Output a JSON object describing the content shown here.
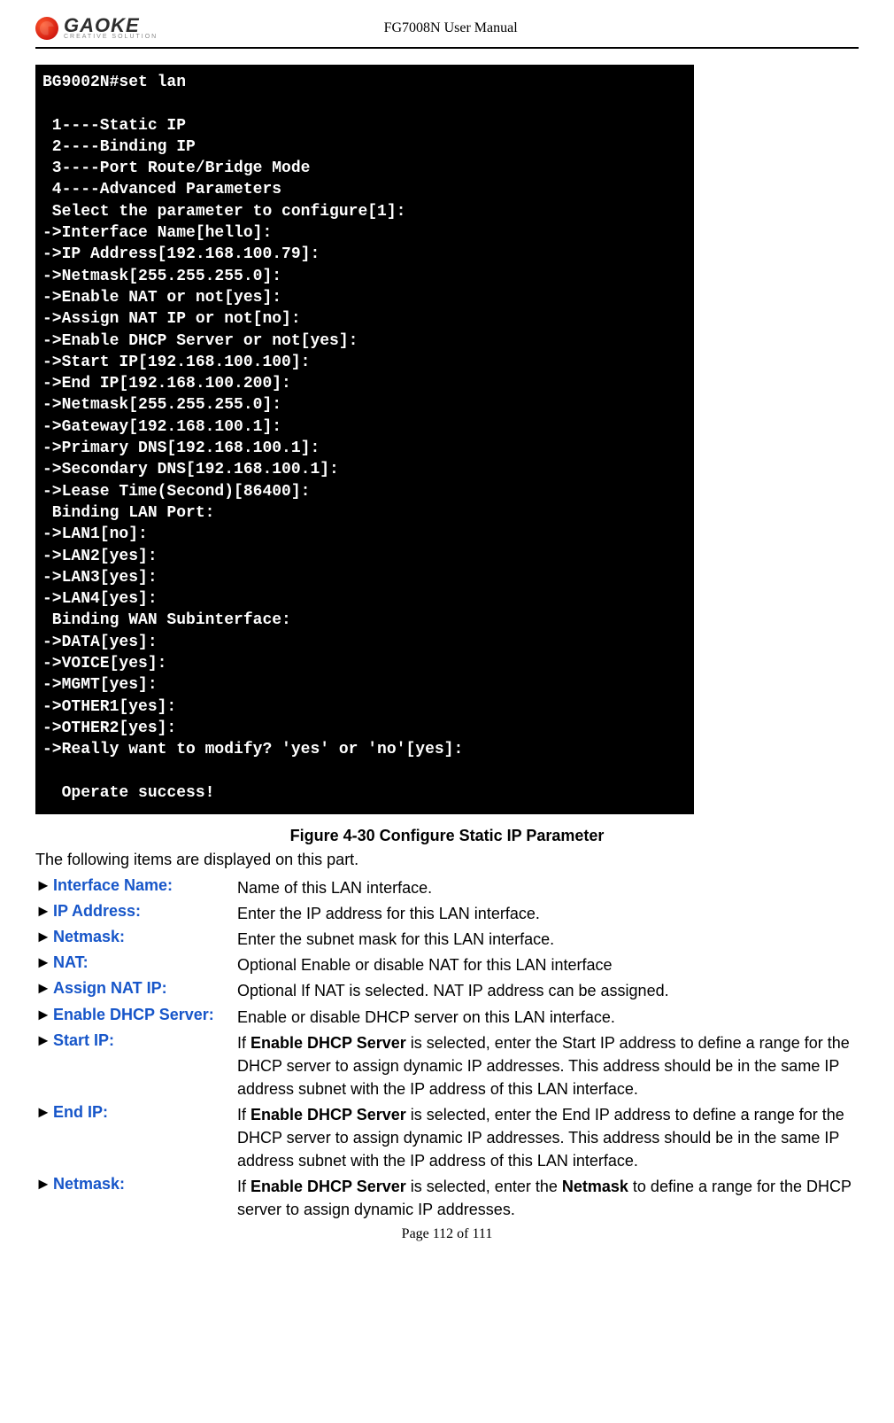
{
  "header": {
    "logo_text": "GAOKE",
    "logo_sub": "CREATIVE SOLUTION",
    "doc_title": "FG7008N User Manual"
  },
  "terminal": {
    "lines": [
      "BG9002N#set lan",
      "",
      " 1----Static IP",
      " 2----Binding IP",
      " 3----Port Route/Bridge Mode",
      " 4----Advanced Parameters",
      " Select the parameter to configure[1]:",
      "->Interface Name[hello]:",
      "->IP Address[192.168.100.79]:",
      "->Netmask[255.255.255.0]:",
      "->Enable NAT or not[yes]:",
      "->Assign NAT IP or not[no]:",
      "->Enable DHCP Server or not[yes]:",
      "->Start IP[192.168.100.100]:",
      "->End IP[192.168.100.200]:",
      "->Netmask[255.255.255.0]:",
      "->Gateway[192.168.100.1]:",
      "->Primary DNS[192.168.100.1]:",
      "->Secondary DNS[192.168.100.1]:",
      "->Lease Time(Second)[86400]:",
      " Binding LAN Port:",
      "->LAN1[no]:",
      "->LAN2[yes]:",
      "->LAN3[yes]:",
      "->LAN4[yes]:",
      " Binding WAN Subinterface:",
      "->DATA[yes]:",
      "->VOICE[yes]:",
      "->MGMT[yes]:",
      "->OTHER1[yes]:",
      "->OTHER2[yes]:",
      "->Really want to modify? 'yes' or 'no'[yes]:",
      "",
      "  Operate success!"
    ]
  },
  "caption": "Figure 4-30   Configure Static IP Parameter",
  "intro": "The following items are displayed on this part.",
  "items": [
    {
      "label": "Interface Name:",
      "desc_plain": "Name of this LAN interface."
    },
    {
      "label": "IP Address:",
      "desc_plain": "Enter the IP address for this LAN interface."
    },
    {
      "label": "Netmask:",
      "desc_plain": "Enter the subnet mask for this LAN interface."
    },
    {
      "label": "NAT:",
      "desc_plain": "Optional Enable or disable NAT for this LAN interface"
    },
    {
      "label": "Assign NAT IP:",
      "desc_plain": "Optional If NAT is selected. NAT IP address can be assigned."
    },
    {
      "label": "Enable DHCP Server:",
      "desc_plain": "Enable or disable DHCP server on this LAN interface."
    },
    {
      "label": "Start IP:",
      "desc_html": "If <b>Enable DHCP Server</b> is selected, enter the Start IP address to define a range for the DHCP server to assign dynamic IP addresses. This address should be in the same IP address subnet with the IP address of this LAN interface."
    },
    {
      "label": "End IP:",
      "desc_html": "If <b>Enable DHCP Server</b> is selected, enter the End IP address to define a range for the DHCP server to assign dynamic IP addresses. This address should be in the same IP address subnet with the IP address of this LAN interface."
    },
    {
      "label": "Netmask:",
      "desc_html": "If <b>Enable DHCP Server</b> is selected, enter the <b>Netmask</b> to define a range for the DHCP server to assign dynamic IP addresses."
    }
  ],
  "footer": "Page 112 of 111"
}
